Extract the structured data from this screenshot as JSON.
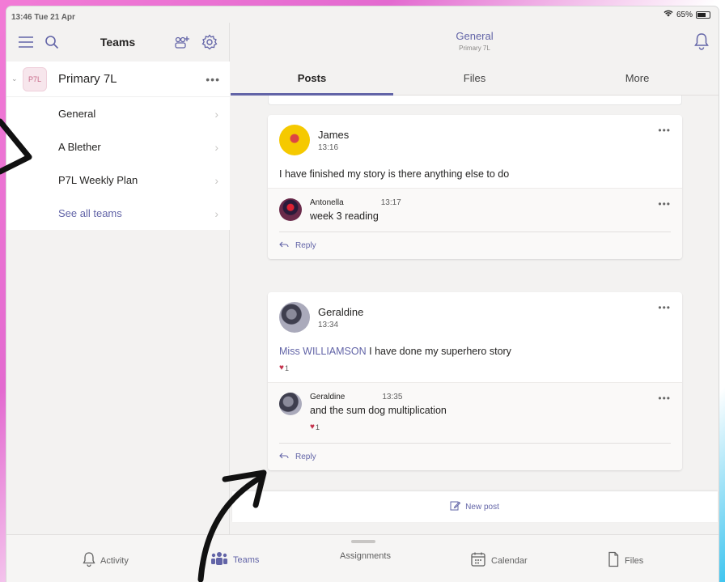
{
  "status": {
    "time_date": "13:46  Tue 21 Apr",
    "battery": "65%"
  },
  "sidebar": {
    "title": "Teams",
    "team": {
      "avatar_text": "P7L",
      "name": "Primary 7L",
      "more": "•••"
    },
    "channels": [
      {
        "label": "General"
      },
      {
        "label": "A Blether"
      },
      {
        "label": "P7L Weekly Plan"
      },
      {
        "label": "See all teams"
      }
    ]
  },
  "main": {
    "channel_title": "General",
    "channel_subtitle": "Primary 7L",
    "tabs": [
      {
        "label": "Posts"
      },
      {
        "label": "Files"
      },
      {
        "label": "More"
      }
    ]
  },
  "posts": [
    {
      "author": "James",
      "time": "13:16",
      "message": "I have finished my story is there anything else to do",
      "replies": [
        {
          "author": "Antonella",
          "time": "13:17",
          "message": "week 3 reading"
        }
      ],
      "reply_label": "Reply"
    },
    {
      "author": "Geraldine",
      "time": "13:34",
      "mention": "Miss WILLIAMSON",
      "message": "I have done my superhero story",
      "reaction_count": "1",
      "replies": [
        {
          "author": "Geraldine",
          "time": "13:35",
          "message": "and the sum dog multiplication",
          "reaction_count": "1"
        }
      ],
      "reply_label": "Reply"
    }
  ],
  "new_post_label": "New post",
  "bottom_nav": [
    {
      "label": "Activity",
      "icon": "bell-icon"
    },
    {
      "label": "Teams",
      "icon": "teams-icon"
    },
    {
      "label": "Assignments",
      "icon": ""
    },
    {
      "label": "Calendar",
      "icon": "calendar-icon"
    },
    {
      "label": "Files",
      "icon": "file-icon"
    }
  ],
  "colors": {
    "accent": "#6264a7",
    "heart": "#c4314b"
  }
}
